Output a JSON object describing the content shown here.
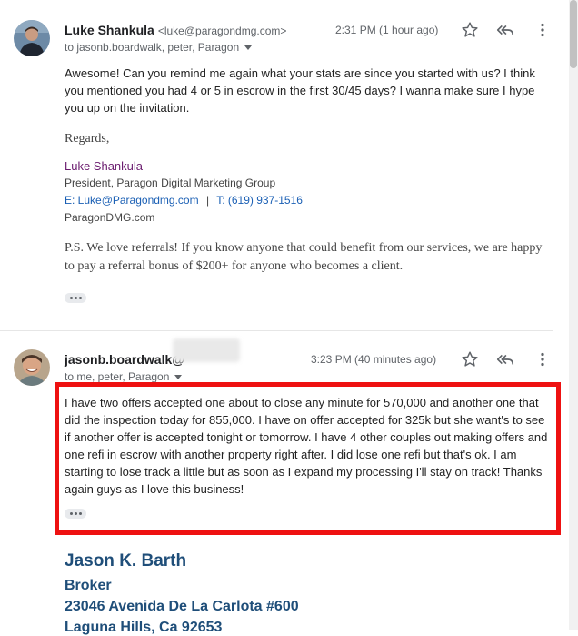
{
  "message1": {
    "sender_name": "Luke Shankula",
    "sender_email": "<luke@paragondmg.com>",
    "to_line": "to jasonb.boardwalk, peter, Paragon",
    "timestamp": "2:31 PM (1 hour ago)",
    "body_lines": [
      "Awesome! Can you remind me again what your stats are since you started with us? I think",
      "you mentioned you had 4 or 5 in escrow in the first 30/45 days? I wanna make sure I hype",
      "you up on the invitation."
    ],
    "regards": "Regards,",
    "signature": {
      "name": "Luke Shankula",
      "title": "President, Paragon Digital Marketing Group",
      "email_label": "E: Luke@Paragondmg.com",
      "separator": "|",
      "phone_label": "T: (619) 937-1516",
      "website": "ParagonDMG.com"
    },
    "ps_lines": [
      "P.S. We love referrals! If you know anyone that could benefit from our services, we are happy",
      "to pay a referral bonus of $200+ for anyone who becomes a client."
    ]
  },
  "message2": {
    "sender_name": "jasonb.boardwalk@",
    "to_line": "to me, peter, Paragon",
    "timestamp": "3:23 PM (40 minutes ago)",
    "body_lines": [
      "I have two offers accepted one about to close any minute for 570,000 and another one that",
      "did the inspection today for 855,000. I have on offer accepted for 325k but she want's to see",
      "if another offer is accepted tonight or tomorrow. I have 4 other couples out making offers and",
      "one refi in escrow with another property right after. I did lose one refi but that's ok. I am",
      "starting to lose track a little but as soon as I expand my processing I'll stay on track! Thanks",
      "again guys as I love this business!"
    ],
    "signature": {
      "name": "Jason K. Barth",
      "role": "Broker",
      "address1": "23046 Avenida De La Carlota #600",
      "address2": "Laguna Hills, Ca 92653"
    }
  },
  "icons": {
    "star": "star-icon",
    "reply_all": "reply-all-icon",
    "more": "more-vert-icon"
  },
  "colors": {
    "highlight": "#ee1111",
    "signature_purple": "#6a1b6e",
    "link_blue": "#1a5fb4",
    "broker_blue": "#1f4e79"
  }
}
